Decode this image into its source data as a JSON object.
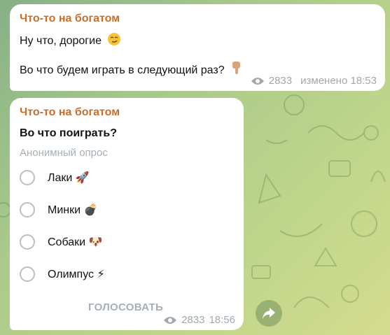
{
  "messages": [
    {
      "sender": "Что-то на богатом",
      "line1": "Ну что, дорогие",
      "line1_emoji": "smirk-emoji",
      "line2": "Во что будем играть в следующий раз?",
      "line2_emoji": "pointing-down-emoji",
      "views": "2833",
      "edited_time": "изменено 18:53"
    },
    {
      "sender": "Что-то на богатом",
      "poll": {
        "question": "Во что поиграть?",
        "type": "Анонимный опрос",
        "options": [
          {
            "label": "Лаки",
            "emoji": "🚀"
          },
          {
            "label": "Минки",
            "emoji": "💣"
          },
          {
            "label": "Собаки",
            "emoji": "🐶"
          },
          {
            "label": "Олимпус",
            "emoji": "⚡"
          }
        ],
        "vote_label": "ГОЛОСОВАТЬ"
      },
      "views": "2833",
      "time": "18:56"
    }
  ],
  "colors": {
    "sender": "#c66e2c",
    "meta": "#a0a8ae",
    "radio_border": "#b8c0c6"
  },
  "icons": {
    "views": "eye-icon",
    "share": "share-arrow-icon"
  }
}
